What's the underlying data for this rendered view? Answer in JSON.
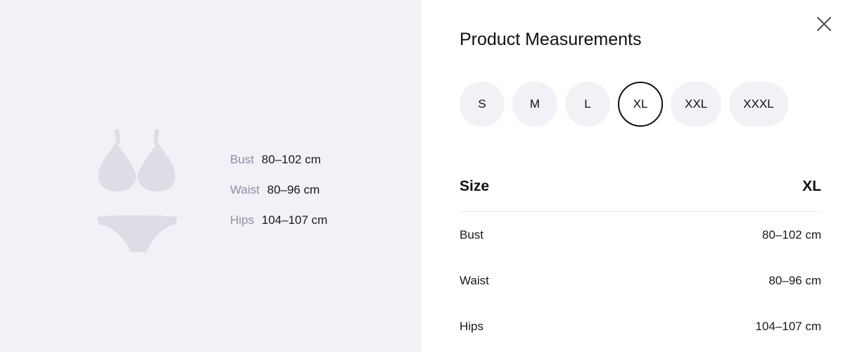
{
  "left_panel": {
    "illustration_icon": "bikini-silhouette-icon",
    "measurements": [
      {
        "label": "Bust",
        "value": "80–102 cm"
      },
      {
        "label": "Waist",
        "value": "80–96 cm"
      },
      {
        "label": "Hips",
        "value": "104–107 cm"
      }
    ]
  },
  "dialog": {
    "title": "Product Measurements",
    "close_icon": "close-icon",
    "sizes": [
      "S",
      "M",
      "L",
      "XL",
      "XXL",
      "XXXL"
    ],
    "selected_size": "XL",
    "table": {
      "header_label": "Size",
      "header_value": "XL",
      "rows": [
        {
          "label": "Bust",
          "value": "80–102 cm"
        },
        {
          "label": "Waist",
          "value": "80–96 cm"
        },
        {
          "label": "Hips",
          "value": "104–107 cm"
        }
      ]
    }
  },
  "colors": {
    "panel_bg": "#f1f2f6",
    "illustration": "#dcdde6",
    "muted_label": "#8d8fa3",
    "selected_border": "#111111"
  }
}
